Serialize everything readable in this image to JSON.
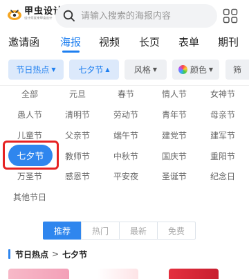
{
  "header": {
    "logo_title": "甲虫设计",
    "logo_sub": "设计师就来甲虫设计",
    "search_placeholder": "请输入搜索的海报内容"
  },
  "tabs": [
    "邀请函",
    "海报",
    "视频",
    "长页",
    "表单",
    "期刊"
  ],
  "active_tab": "海报",
  "filters": {
    "hot": "节日热点",
    "qixi": "七夕节",
    "style": "风格",
    "color": "颜色",
    "more": "筛"
  },
  "festivals": {
    "row1": [
      "全部",
      "元旦",
      "春节",
      "情人节",
      "女神节"
    ],
    "row2": [
      "愚人节",
      "清明节",
      "劳动节",
      "青年节",
      "母亲节"
    ],
    "row3": [
      "儿童节",
      "父亲节",
      "端午节",
      "建党节",
      "建军节"
    ],
    "row4": [
      "七夕节",
      "教师节",
      "中秋节",
      "国庆节",
      "重阳节"
    ],
    "row5": [
      "万圣节",
      "感恩节",
      "平安夜",
      "圣诞节",
      "纪念日"
    ],
    "row6": [
      "其他节日"
    ]
  },
  "sort": [
    "推荐",
    "热门",
    "最新",
    "免费"
  ],
  "breadcrumb": {
    "parent": "节日热点",
    "arrow": ">",
    "current": "七夕节"
  },
  "colors": {
    "accent": "#1e7ff0",
    "highlight_box": "#e62222"
  }
}
